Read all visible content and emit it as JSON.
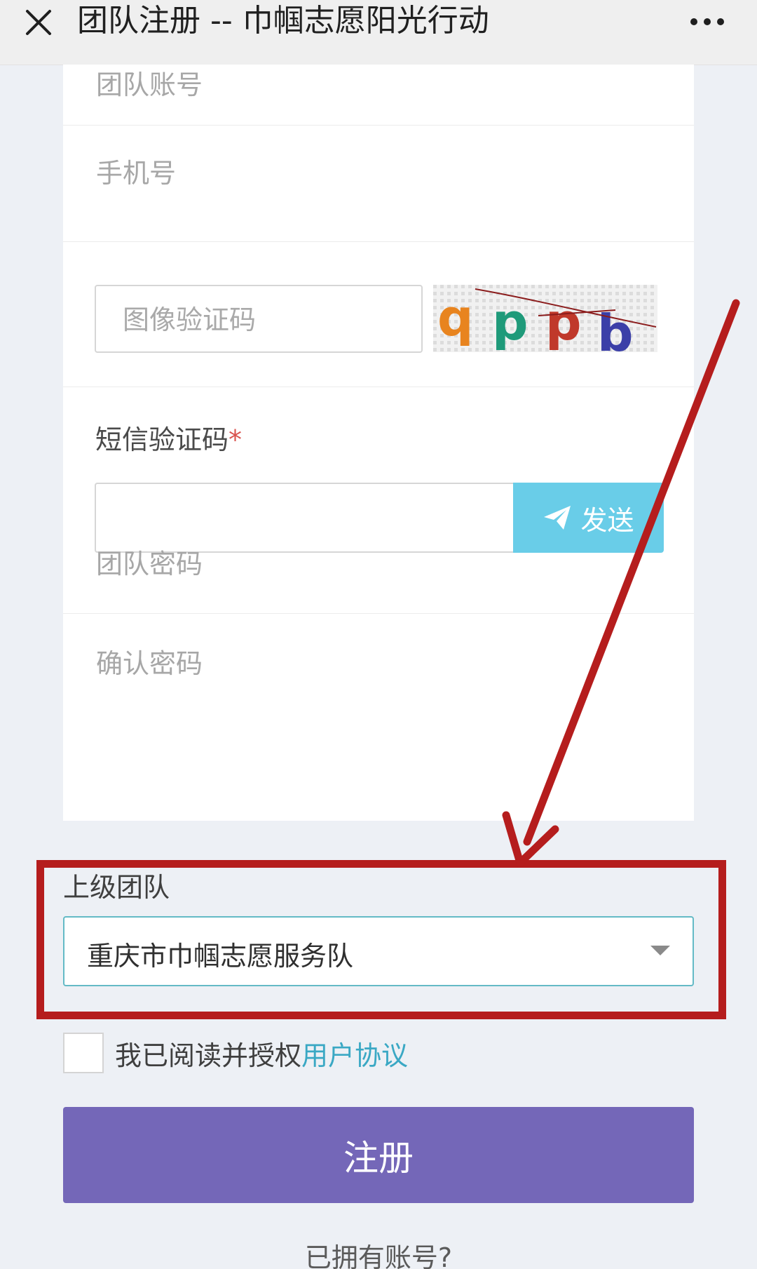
{
  "nav": {
    "title": "团队注册 -- 巾帼志愿阳光行动"
  },
  "form": {
    "team_account_placeholder": "团队账号",
    "phone_placeholder": "手机号",
    "image_captcha_placeholder": "图像验证码",
    "captcha_chars": "qppb",
    "sms_label": "短信验证码",
    "required_mark": "*",
    "sms_value": "",
    "send_label": "发送",
    "password_placeholder": "团队密码",
    "confirm_password_placeholder": "确认密码"
  },
  "parent_team": {
    "label": "上级团队",
    "selected": "重庆市巾帼志愿服务队"
  },
  "agreement": {
    "text": "我已阅读并授权",
    "link": "用户协议"
  },
  "register_label": "注册",
  "login_prompt": "已拥有账号?",
  "colors": {
    "accent_purple": "#7467b8",
    "send_blue": "#69cde8",
    "link_teal": "#3aa8c4",
    "annotation_red": "#b51d1d"
  }
}
